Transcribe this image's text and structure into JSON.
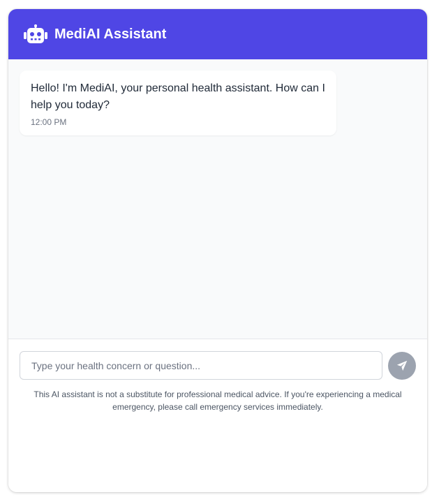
{
  "header": {
    "title": "MediAI Assistant",
    "icon": "robot-icon",
    "background": "#4f46e5"
  },
  "messages": [
    {
      "sender": "assistant",
      "text": "Hello! I'm MediAI, your personal health assistant. How can I help you today?",
      "time": "12:00 PM"
    }
  ],
  "composer": {
    "placeholder": "Type your health concern or question...",
    "value": "",
    "send_icon": "paper-plane-icon",
    "send_button_color": "#9ca3af",
    "disclaimer": "This AI assistant is not a substitute for professional medical advice. If you're experiencing a medical emergency, please call emergency services immediately."
  }
}
